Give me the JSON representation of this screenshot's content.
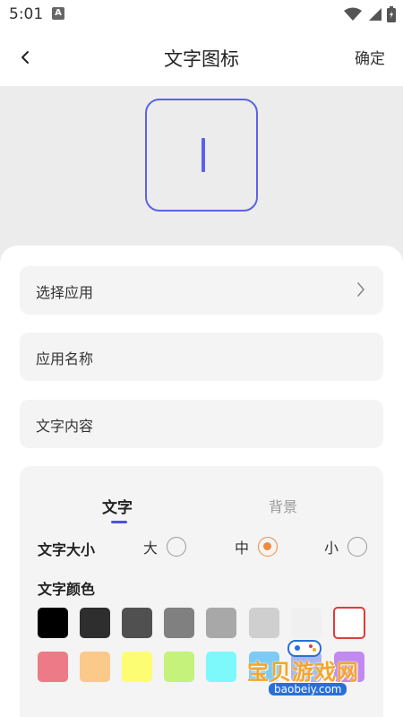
{
  "status": {
    "time": "5:01",
    "notif_letter": "A"
  },
  "nav": {
    "title": "文字图标",
    "confirm": "确定"
  },
  "preview": {
    "char": ""
  },
  "fields": [
    {
      "label": "选择应用"
    },
    {
      "label": "应用名称"
    },
    {
      "label": "文字内容"
    }
  ],
  "tabs": {
    "text": "文字",
    "background": "背景"
  },
  "size": {
    "label": "文字大小",
    "options": [
      "大",
      "中",
      "小"
    ],
    "selected": "中"
  },
  "color": {
    "label": "文字颜色",
    "row1": [
      "#000000",
      "#2e2e2e",
      "#505050",
      "#808080",
      "#a8a8a8",
      "#cfcfcf",
      "#f0f0f0",
      "#ffffff"
    ],
    "row2": [
      "#ec7b87",
      "#fbc98a",
      "#fdfd73",
      "#c4f27a",
      "#7ef9fb",
      "#7ccbf5",
      "#a9b6ef",
      "#c08af0"
    ],
    "selected": "#ffffff"
  },
  "watermark": {
    "title": "宝贝游戏网",
    "url": "baobeiy.com"
  }
}
